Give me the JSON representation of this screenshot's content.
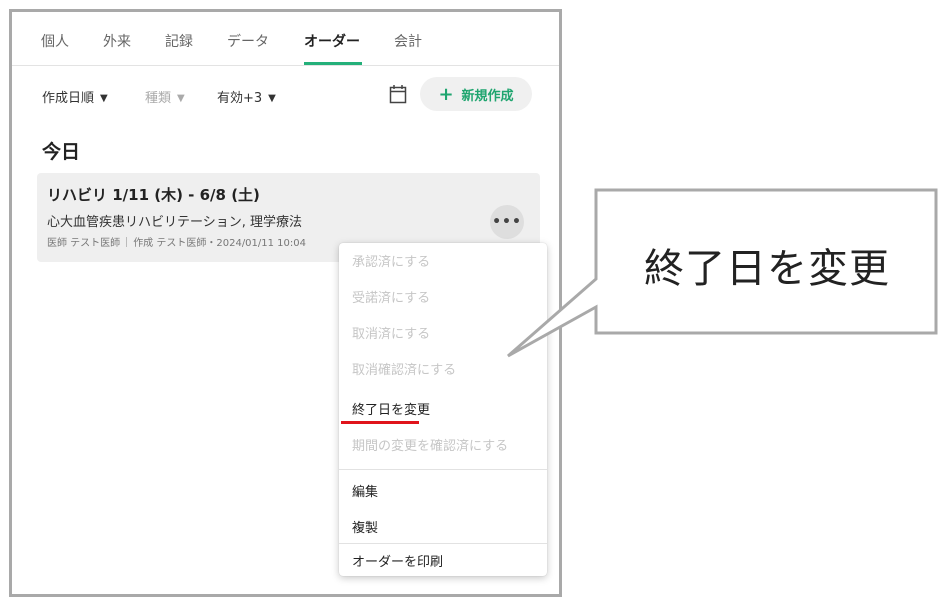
{
  "tabs": [
    {
      "label": "個人",
      "active": false
    },
    {
      "label": "外来",
      "active": false
    },
    {
      "label": "記録",
      "active": false
    },
    {
      "label": "データ",
      "active": false
    },
    {
      "label": "オーダー",
      "active": true
    },
    {
      "label": "会計",
      "active": false
    }
  ],
  "toolbar": {
    "sort_label": "作成日順",
    "type_label": "種類",
    "status_label": "有効+3",
    "new_button_label": "新規作成",
    "accent_color": "#1fa56f"
  },
  "section_title": "今日",
  "order_card": {
    "title": "リハビリ 1/11 (木) - 6/8 (土)",
    "subtitle": "心大血管疾患リハビリテーション, 理学療法",
    "doctor": "医師 テスト医師",
    "created": "作成 テスト医師・2024/01/11 10:04",
    "more_icon": "more-horizontal-icon"
  },
  "menu": {
    "items": [
      {
        "label": "承認済にする",
        "enabled": false
      },
      {
        "label": "受諾済にする",
        "enabled": false
      },
      {
        "label": "取消済にする",
        "enabled": false
      },
      {
        "label": "取消確認済にする",
        "enabled": false
      },
      {
        "label": "終了日を変更",
        "enabled": true,
        "highlighted": true
      },
      {
        "label": "期間の変更を確認済にする",
        "enabled": false
      },
      {
        "label": "編集",
        "enabled": true
      },
      {
        "label": "複製",
        "enabled": true
      },
      {
        "label": "オーダーを印刷",
        "enabled": true
      }
    ]
  },
  "callout": {
    "text": "終了日を変更"
  }
}
